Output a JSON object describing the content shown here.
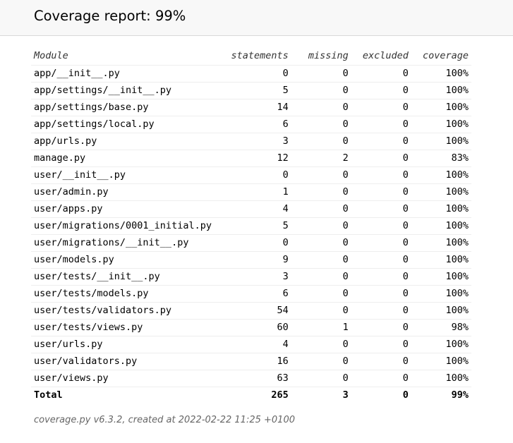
{
  "header": {
    "title": "Coverage report: 99%"
  },
  "table": {
    "columns": {
      "module": "Module",
      "statements": "statements",
      "missing": "missing",
      "excluded": "excluded",
      "coverage": "coverage"
    },
    "rows": [
      {
        "module": "app/__init__.py",
        "statements": "0",
        "missing": "0",
        "excluded": "0",
        "coverage": "100%"
      },
      {
        "module": "app/settings/__init__.py",
        "statements": "5",
        "missing": "0",
        "excluded": "0",
        "coverage": "100%"
      },
      {
        "module": "app/settings/base.py",
        "statements": "14",
        "missing": "0",
        "excluded": "0",
        "coverage": "100%"
      },
      {
        "module": "app/settings/local.py",
        "statements": "6",
        "missing": "0",
        "excluded": "0",
        "coverage": "100%"
      },
      {
        "module": "app/urls.py",
        "statements": "3",
        "missing": "0",
        "excluded": "0",
        "coverage": "100%"
      },
      {
        "module": "manage.py",
        "statements": "12",
        "missing": "2",
        "excluded": "0",
        "coverage": "83%"
      },
      {
        "module": "user/__init__.py",
        "statements": "0",
        "missing": "0",
        "excluded": "0",
        "coverage": "100%"
      },
      {
        "module": "user/admin.py",
        "statements": "1",
        "missing": "0",
        "excluded": "0",
        "coverage": "100%"
      },
      {
        "module": "user/apps.py",
        "statements": "4",
        "missing": "0",
        "excluded": "0",
        "coverage": "100%"
      },
      {
        "module": "user/migrations/0001_initial.py",
        "statements": "5",
        "missing": "0",
        "excluded": "0",
        "coverage": "100%"
      },
      {
        "module": "user/migrations/__init__.py",
        "statements": "0",
        "missing": "0",
        "excluded": "0",
        "coverage": "100%"
      },
      {
        "module": "user/models.py",
        "statements": "9",
        "missing": "0",
        "excluded": "0",
        "coverage": "100%"
      },
      {
        "module": "user/tests/__init__.py",
        "statements": "3",
        "missing": "0",
        "excluded": "0",
        "coverage": "100%"
      },
      {
        "module": "user/tests/models.py",
        "statements": "6",
        "missing": "0",
        "excluded": "0",
        "coverage": "100%"
      },
      {
        "module": "user/tests/validators.py",
        "statements": "54",
        "missing": "0",
        "excluded": "0",
        "coverage": "100%"
      },
      {
        "module": "user/tests/views.py",
        "statements": "60",
        "missing": "1",
        "excluded": "0",
        "coverage": "98%"
      },
      {
        "module": "user/urls.py",
        "statements": "4",
        "missing": "0",
        "excluded": "0",
        "coverage": "100%"
      },
      {
        "module": "user/validators.py",
        "statements": "16",
        "missing": "0",
        "excluded": "0",
        "coverage": "100%"
      },
      {
        "module": "user/views.py",
        "statements": "63",
        "missing": "0",
        "excluded": "0",
        "coverage": "100%"
      }
    ],
    "total": {
      "module": "Total",
      "statements": "265",
      "missing": "3",
      "excluded": "0",
      "coverage": "99%"
    }
  },
  "footer": {
    "text": "coverage.py v6.3.2, created at 2022-02-22 11:25 +0100"
  }
}
